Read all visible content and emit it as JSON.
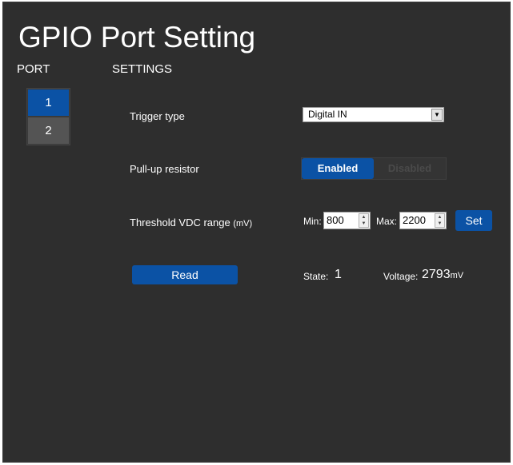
{
  "page": {
    "title": "GPIO Port Setting"
  },
  "columns": {
    "port": "PORT",
    "settings": "SETTINGS"
  },
  "ports": [
    {
      "label": "1",
      "active": true
    },
    {
      "label": "2",
      "active": false
    }
  ],
  "trigger": {
    "label": "Trigger type",
    "value": "Digital IN"
  },
  "pullup": {
    "label": "Pull-up resistor",
    "enabled_label": "Enabled",
    "disabled_label": "Disabled",
    "selected": "Enabled"
  },
  "threshold": {
    "label": "Threshold VDC range",
    "unit_label": "(mV)",
    "min_label": "Min:",
    "min_value": "800",
    "max_label": "Max:",
    "max_value": "2200",
    "set_label": "Set"
  },
  "read": {
    "button_label": "Read",
    "state_label": "State:",
    "state_value": "1",
    "voltage_label": "Voltage:",
    "voltage_value": "2793",
    "voltage_unit": "mV"
  },
  "colors": {
    "accent": "#0b52a5",
    "panel": "#2e2e2e",
    "inactive": "#545454"
  }
}
